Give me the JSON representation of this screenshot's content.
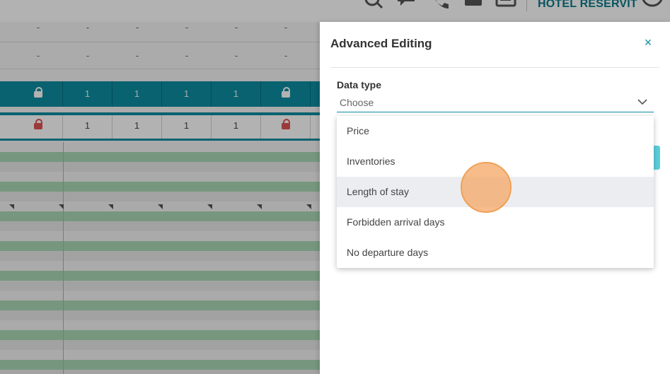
{
  "header": {
    "brand": "HOTEL RESERVIT",
    "icons": [
      "search-icon",
      "chat-icon",
      "phone-icon",
      "mail-icon",
      "inbox-icon",
      "user-icon"
    ]
  },
  "grid": {
    "dash_rows": [
      [
        "-",
        "-",
        "-",
        "-",
        "-",
        "-",
        "-"
      ],
      [
        "-",
        "-",
        "-",
        "-",
        "-",
        "-",
        "-"
      ]
    ],
    "teal_row": [
      "",
      "lock",
      "1",
      "1",
      "1",
      "1",
      "lock"
    ],
    "white_row": [
      "",
      "lock",
      "1",
      "1",
      "1",
      "1",
      "lock"
    ]
  },
  "panel": {
    "title": "Advanced Editing",
    "close_label": "×",
    "field_label": "Data type",
    "select_value": "Choose",
    "options": [
      "Price",
      "Inventories",
      "Length of stay",
      "Forbidden arrival days",
      "No departure days"
    ],
    "hovered_option": "Length of stay"
  },
  "colors": {
    "accent": "#0e8da1",
    "stripe_green": "#a9d8b5",
    "lock_red": "#e05252",
    "click_marker": "#f5a664"
  }
}
